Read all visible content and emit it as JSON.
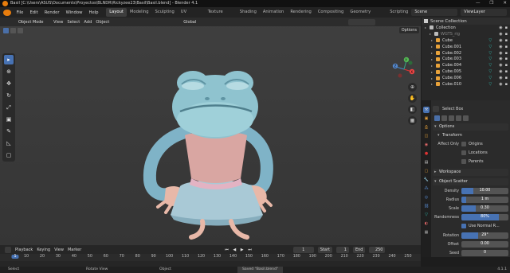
{
  "window": {
    "title": "Basil [C:\\Users\\ASUS\\Documents\\Proyectos\\BLNDR\\Rickyzee23\\Basil\\Basil.blend] - Blender 4.1",
    "controls": [
      "—",
      "❐",
      "✕"
    ]
  },
  "menu": {
    "items": [
      "File",
      "Edit",
      "Render",
      "Window",
      "Help"
    ],
    "workspaces": [
      "Layout",
      "Modeling",
      "Sculpting",
      "UV Editing",
      "Texture Paint",
      "Shading",
      "Animation",
      "Rendering",
      "Compositing",
      "Geometry Nodes",
      "Scripting"
    ],
    "active_workspace": "Layout",
    "scene": "Scene",
    "view_layer": "ViewLayer"
  },
  "viewport": {
    "mode": "Object Mode",
    "menus": [
      "View",
      "Select",
      "Add",
      "Object"
    ],
    "orientation": "Global",
    "options": "Options",
    "gizmo": {
      "x_label": "X",
      "y_label": "Y",
      "z_label": "Z"
    }
  },
  "outliner": {
    "title": "Scene Collection",
    "rows": [
      {
        "name": "Collection",
        "kind": "collection"
      },
      {
        "name": "WGTS_rig",
        "kind": "collection",
        "dim": true
      },
      {
        "name": "Cube",
        "kind": "object"
      },
      {
        "name": "Cube.001",
        "kind": "object"
      },
      {
        "name": "Cube.002",
        "kind": "object"
      },
      {
        "name": "Cube.003",
        "kind": "object"
      },
      {
        "name": "Cube.004",
        "kind": "object"
      },
      {
        "name": "Cube.005",
        "kind": "object"
      },
      {
        "name": "Cube.006",
        "kind": "object"
      },
      {
        "name": "Cube.010",
        "kind": "object"
      }
    ]
  },
  "properties": {
    "tool_name": "Select Box",
    "options_label": "Options",
    "transform_label": "Transform",
    "affect_only": "Affect Only",
    "affect_items": [
      "Origins",
      "Locations",
      "Parents"
    ],
    "workspace_label": "Workspace",
    "scatter_label": "Object Scatter",
    "fields": [
      {
        "label": "Density",
        "value": "10.00",
        "fill": 0.25
      },
      {
        "label": "Radius",
        "value": "1 m",
        "fill": 0.1
      },
      {
        "label": "Scale",
        "value": "0.30",
        "fill": 0.3
      },
      {
        "label": "Randomness",
        "value": "80%",
        "fill": 0.8
      }
    ],
    "use_normal_label": "Use Normal R...",
    "fields2": [
      {
        "label": "Rotation",
        "value": "29°",
        "fill": 0.35
      },
      {
        "label": "Offset",
        "value": "0.00",
        "fill": 0
      },
      {
        "label": "Seed",
        "value": "0",
        "fill": 0
      }
    ]
  },
  "timeline": {
    "menus": [
      "Playback",
      "Keying",
      "View",
      "Marker"
    ],
    "current_frame": "1",
    "start_label": "Start",
    "start": "1",
    "end_label": "End",
    "end": "250",
    "ticks": [
      "1",
      "10",
      "20",
      "30",
      "40",
      "50",
      "60",
      "70",
      "80",
      "90",
      "100",
      "110",
      "120",
      "130",
      "140",
      "150",
      "160",
      "170",
      "180",
      "190",
      "200",
      "210",
      "220",
      "230",
      "240",
      "250"
    ]
  },
  "status": {
    "select": "Select",
    "rotate": "Rotate View",
    "object": "Object",
    "saved": "Saved \"Basil.blend\"",
    "version": "4.1.1"
  },
  "colors": {
    "accent": "#4772b3",
    "skin": "#8fc3cf",
    "dress": "#d9a6a2",
    "hands": "#e8b8a8"
  }
}
